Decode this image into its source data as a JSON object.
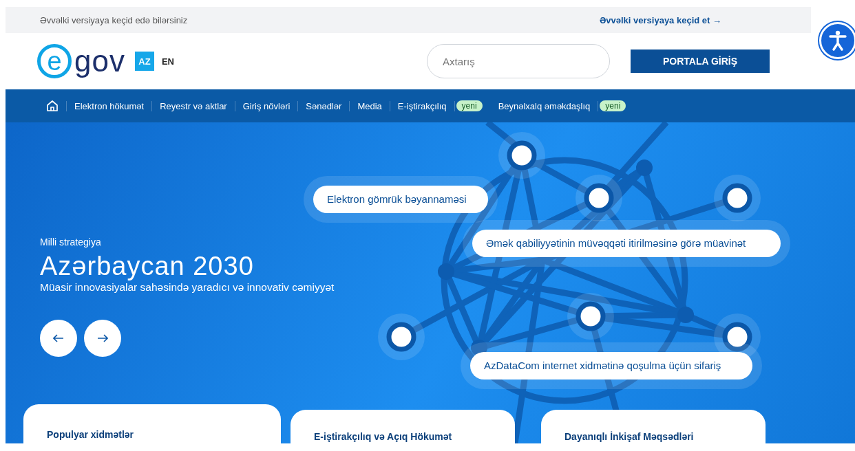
{
  "top_bar": {
    "text": "Əvvəlki versiyaya keçid edə bilərsiniz",
    "link": "Əvvəlki versiyaya keçid et →"
  },
  "header": {
    "logo": {
      "mark": "e",
      "text": "gov"
    },
    "languages": [
      {
        "label": "AZ",
        "selected": true
      },
      {
        "label": "EN",
        "selected": false
      }
    ],
    "search": {
      "placeholder": "Axtarış"
    },
    "login_button": "PORTALA GİRİŞ"
  },
  "nav": {
    "items": [
      {
        "label": "Elektron hökumət"
      },
      {
        "label": "Reyestr və aktlar"
      },
      {
        "label": "Giriş növləri"
      },
      {
        "label": "Sənədlər"
      },
      {
        "label": "Media"
      },
      {
        "label": "E-iştirakçılıq",
        "badge": "yeni"
      },
      {
        "label": "Beynəlxalq əməkdaşlıq",
        "badge": "yeni"
      }
    ]
  },
  "hero": {
    "eyebrow": "Milli strategiya",
    "title": "Azərbaycan 2030",
    "subtitle": "Müasir innovasiyalar sahəsində yaradıcı və innovativ cəmiyyət",
    "services": [
      "Elektron gömrük bəyannaməsi",
      "Əmək qabiliyyətinin müvəqqəti itirilməsinə görə müavinət",
      "AzDataCom internet xidmətinə qoşulma üçün sifariş"
    ]
  },
  "cards": [
    {
      "title": "Populyar xidmətlər"
    },
    {
      "title": "E-iştirakçılıq və Açıq Hökumət"
    },
    {
      "title": "Dayanıqlı İnkişaf Məqsədləri"
    }
  ]
}
